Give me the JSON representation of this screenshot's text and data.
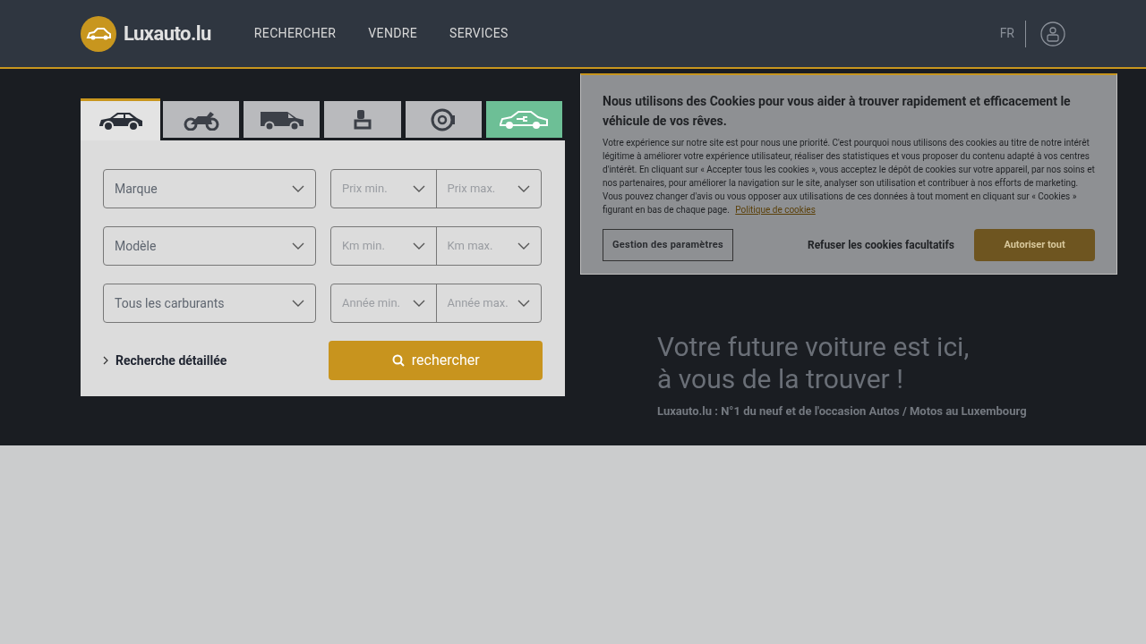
{
  "header": {
    "logo": "Luxauto.lu",
    "nav": [
      "RECHERCHER",
      "VENDRE",
      "SERVICES"
    ],
    "language": "FR"
  },
  "search": {
    "tabs": [
      {
        "kind": "car",
        "selected": true
      },
      {
        "kind": "motorbike",
        "selected": false
      },
      {
        "kind": "van",
        "selected": false
      },
      {
        "kind": "camper",
        "selected": false
      },
      {
        "kind": "tire",
        "selected": false
      },
      {
        "kind": "electric",
        "selected": false
      }
    ],
    "left_fields": [
      "Marque",
      "Modèle",
      "Tous les carburants"
    ],
    "range_fields": [
      [
        "Prix min.",
        "Prix max."
      ],
      [
        "Km min.",
        "Km max."
      ],
      [
        "Année min.",
        "Année max."
      ]
    ],
    "detailed_link": "Recherche détaillée",
    "search_button": "rechercher"
  },
  "hero": {
    "title_lines": [
      "Votre future voiture est ici,",
      "à vous de la trouver !"
    ],
    "subtitle": "Luxauto.lu : N°1 du neuf et de l'occasion Autos / Motos au Luxembourg"
  },
  "cookie_dialog": {
    "title": "Nous utilisons des Cookies pour vous aider à trouver rapidement et efficacement le véhicule de vos rêves.",
    "body": "Votre expérience sur notre site est pour nous une priorité. C'est pourquoi nous utilisons des cookies au titre de notre intérêt légitime à améliorer votre expérience utilisateur, réaliser des statistiques et vous proposer du contenu adapté à vos centres d'intérêt. En cliquant sur « Accepter tous les cookies », vous acceptez le dépôt de cookies sur votre appareil, par nos soins et nos partenaires, pour améliorer la navigation sur le site, analyser son utilisation et contribuer à nos efforts de marketing. Vous pouvez changer d'avis ou vous opposer aux utilisations de ces données à tout moment en cliquant sur « Cookies » figurant en bas de chaque page.",
    "policy_link": "Politique de cookies",
    "settings_button": "Gestion des paramètres",
    "refuse_button": "Refuser les cookies facultatifs",
    "accept_button": "Autoriser tout"
  }
}
